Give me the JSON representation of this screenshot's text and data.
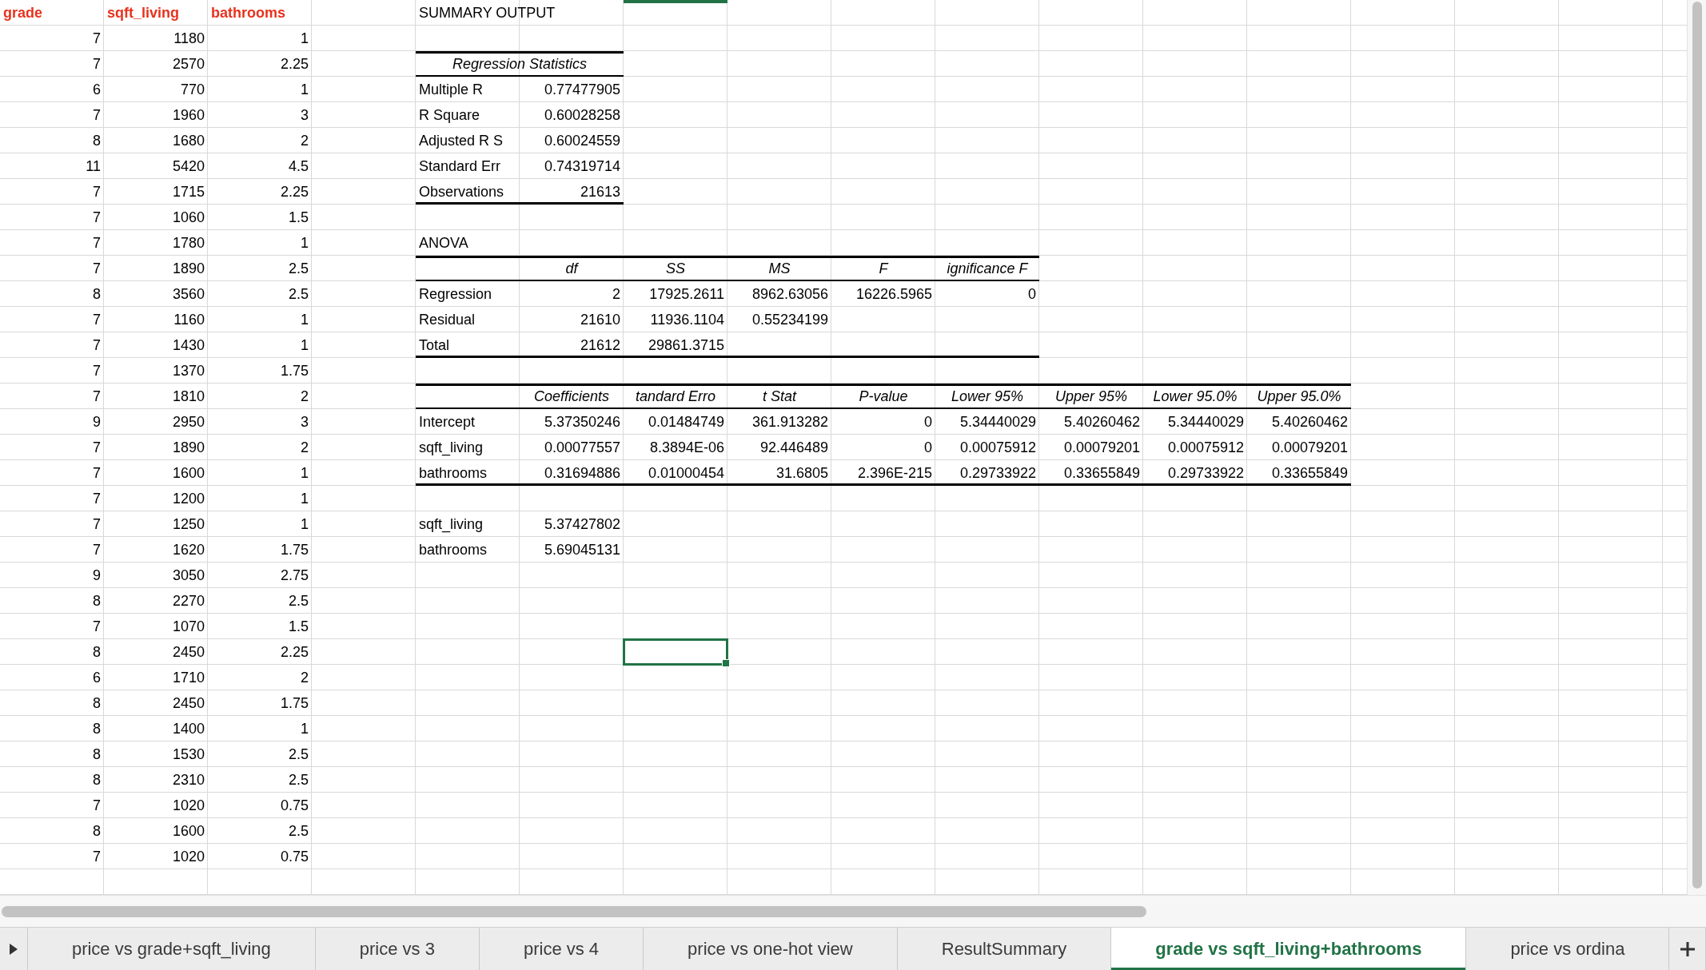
{
  "data_table": {
    "columns": [
      "grade",
      "sqft_living",
      "bathrooms"
    ],
    "rows": [
      [
        "7",
        "1180",
        "1"
      ],
      [
        "7",
        "2570",
        "2.25"
      ],
      [
        "6",
        "770",
        "1"
      ],
      [
        "7",
        "1960",
        "3"
      ],
      [
        "8",
        "1680",
        "2"
      ],
      [
        "11",
        "5420",
        "4.5"
      ],
      [
        "7",
        "1715",
        "2.25"
      ],
      [
        "7",
        "1060",
        "1.5"
      ],
      [
        "7",
        "1780",
        "1"
      ],
      [
        "7",
        "1890",
        "2.5"
      ],
      [
        "8",
        "3560",
        "2.5"
      ],
      [
        "7",
        "1160",
        "1"
      ],
      [
        "7",
        "1430",
        "1"
      ],
      [
        "7",
        "1370",
        "1.75"
      ],
      [
        "7",
        "1810",
        "2"
      ],
      [
        "9",
        "2950",
        "3"
      ],
      [
        "7",
        "1890",
        "2"
      ],
      [
        "7",
        "1600",
        "1"
      ],
      [
        "7",
        "1200",
        "1"
      ],
      [
        "7",
        "1250",
        "1"
      ],
      [
        "7",
        "1620",
        "1.75"
      ],
      [
        "9",
        "3050",
        "2.75"
      ],
      [
        "8",
        "2270",
        "2.5"
      ],
      [
        "7",
        "1070",
        "1.5"
      ],
      [
        "8",
        "2450",
        "2.25"
      ],
      [
        "6",
        "1710",
        "2"
      ],
      [
        "8",
        "2450",
        "1.75"
      ],
      [
        "8",
        "1400",
        "1"
      ],
      [
        "8",
        "1530",
        "2.5"
      ],
      [
        "8",
        "2310",
        "2.5"
      ],
      [
        "7",
        "1020",
        "0.75"
      ],
      [
        "8",
        "1600",
        "2.5"
      ],
      [
        "7",
        "1020",
        "0.75"
      ]
    ]
  },
  "summary_output": {
    "title": "SUMMARY OUTPUT",
    "regression_statistics": {
      "heading": "Regression Statistics",
      "rows": [
        [
          "Multiple R",
          "0.77477905"
        ],
        [
          "R Square",
          "0.60028258"
        ],
        [
          "Adjusted R S",
          "0.60024559"
        ],
        [
          "Standard Err",
          "0.74319714"
        ],
        [
          "Observations",
          "21613"
        ]
      ]
    },
    "anova": {
      "title": "ANOVA",
      "columns": [
        "",
        "df",
        "SS",
        "MS",
        "F",
        "ignificance F"
      ],
      "rows": [
        [
          "Regression",
          "2",
          "17925.2611",
          "8962.63056",
          "16226.5965",
          "0"
        ],
        [
          "Residual",
          "21610",
          "11936.1104",
          "0.55234199"
        ],
        [
          "Total",
          "21612",
          "29861.3715"
        ]
      ]
    },
    "coefficients": {
      "columns": [
        "",
        "Coefficients",
        "tandard Erro",
        "t Stat",
        "P-value",
        "Lower 95%",
        "Upper 95%",
        "Lower 95.0%",
        "Upper 95.0%"
      ],
      "rows": [
        [
          "Intercept",
          "5.37350246",
          "0.01484749",
          "361.913282",
          "0",
          "5.34440029",
          "5.40260462",
          "5.34440029",
          "5.40260462"
        ],
        [
          "sqft_living",
          "0.00077557",
          "8.3894E-06",
          "92.446489",
          "0",
          "0.00075912",
          "0.00079201",
          "0.00075912",
          "0.00079201"
        ],
        [
          "bathrooms",
          "0.31694886",
          "0.01000454",
          "31.6805",
          "2.396E-215",
          "0.29733922",
          "0.33655849",
          "0.29733922",
          "0.33655849"
        ]
      ]
    },
    "extra_rows": [
      [
        "sqft_living",
        "5.37427802"
      ],
      [
        "bathrooms",
        "5.69045131"
      ]
    ]
  },
  "sheet_tabs": [
    {
      "label": "price vs grade+sqft_living",
      "selected": false
    },
    {
      "label": "price vs 3",
      "selected": false
    },
    {
      "label": "price vs 4",
      "selected": false
    },
    {
      "label": "price vs one-hot view",
      "selected": false
    },
    {
      "label": "ResultSummary",
      "selected": false
    },
    {
      "label": "grade vs sqft_living+bathrooms",
      "selected": true
    },
    {
      "label": "price vs ordina",
      "selected": false
    }
  ]
}
